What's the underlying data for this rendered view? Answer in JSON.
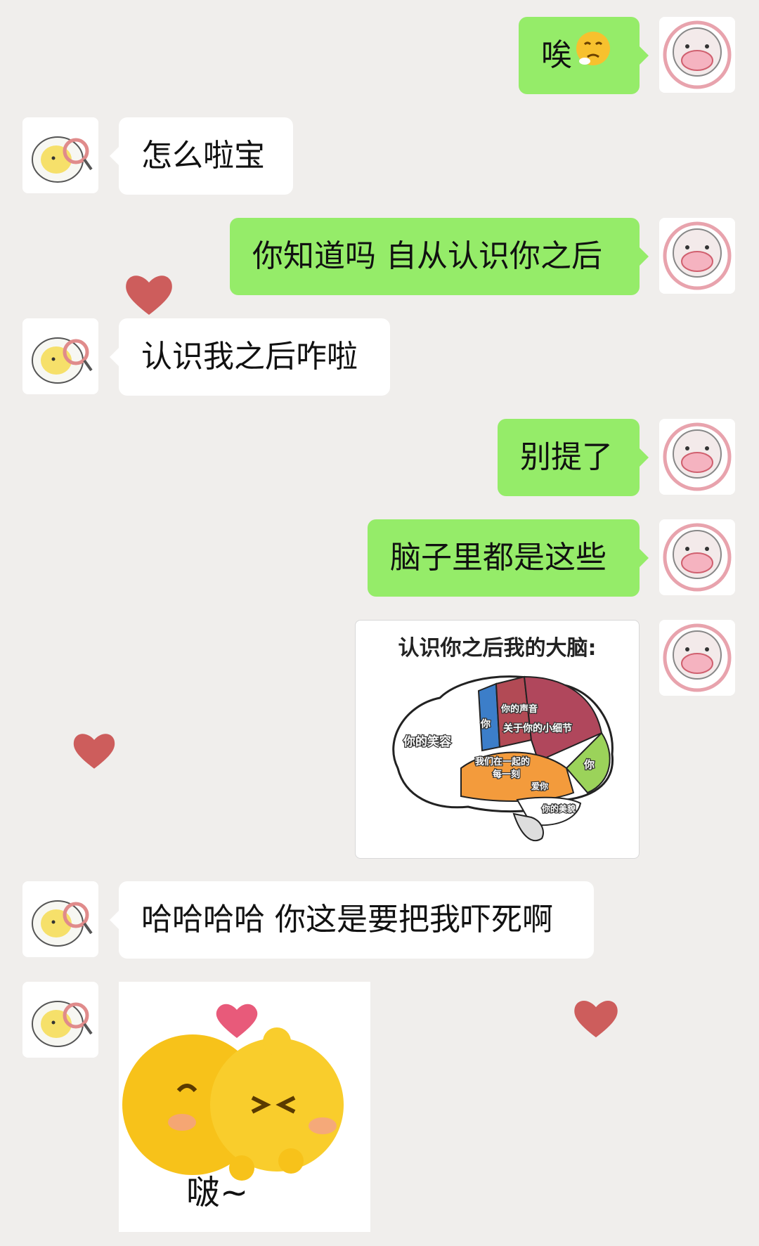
{
  "messages": [
    {
      "side": "me",
      "text": "唉",
      "emoji": "sad-face-emoji"
    },
    {
      "side": "other",
      "text": "怎么啦宝"
    },
    {
      "side": "me",
      "text": "你知道吗 自从认识你之后"
    },
    {
      "side": "other",
      "text": "认识我之后咋啦"
    },
    {
      "side": "me",
      "text": "别提了"
    },
    {
      "side": "me",
      "text": "脑子里都是这些"
    },
    {
      "side": "me",
      "type": "image",
      "image": {
        "title": "认识你之后我的大脑:",
        "regions": [
          "你的笑容",
          "你",
          "你的声音",
          "关于你的小细节",
          "我们在一起的",
          "每一刻",
          "你",
          "爱你",
          "你的美貌"
        ]
      }
    },
    {
      "side": "other",
      "text": "哈哈哈哈 你这是要把我吓死啊"
    },
    {
      "side": "other",
      "type": "sticker",
      "sticker": {
        "text": "啵~",
        "content": "two-emoji-faces-kiss"
      }
    }
  ],
  "colors": {
    "background": "#f0eeec",
    "my_bubble": "#95ec69",
    "other_bubble": "#ffffff",
    "heart": "#c94c4c"
  },
  "icons": {
    "my_avatar": "cartoon-sheep-avatar",
    "other_avatar": "cartoon-egg-with-magnifier-avatar",
    "decoration": "heart-icon"
  }
}
